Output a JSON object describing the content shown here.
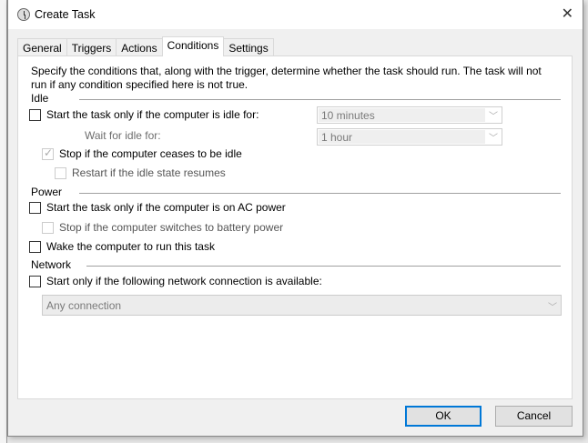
{
  "window": {
    "title": "Create Task"
  },
  "tabs": [
    "General",
    "Triggers",
    "Actions",
    "Conditions",
    "Settings"
  ],
  "description": {
    "line1": "Specify the conditions that, along with the trigger, determine whether the task should run.  The task will not",
    "line2": "run  if any condition specified here is not true."
  },
  "idle": {
    "heading": "Idle",
    "start_idle": "Start the task only if the computer is idle for:",
    "idle_duration": "10 minutes",
    "wait_label": "Wait for idle for:",
    "wait_duration": "1 hour",
    "stop_idle": "Stop if the computer ceases to be idle",
    "restart_idle": "Restart if the idle state resumes"
  },
  "power": {
    "heading": "Power",
    "ac_power": "Start the task only if the computer is on AC power",
    "battery": "Stop if the computer switches to battery power",
    "wake": "Wake the computer to run this task"
  },
  "network": {
    "heading": "Network",
    "start_network": "Start only if the following network connection is available:",
    "connection": "Any connection"
  },
  "buttons": {
    "ok": "OK",
    "cancel": "Cancel"
  }
}
